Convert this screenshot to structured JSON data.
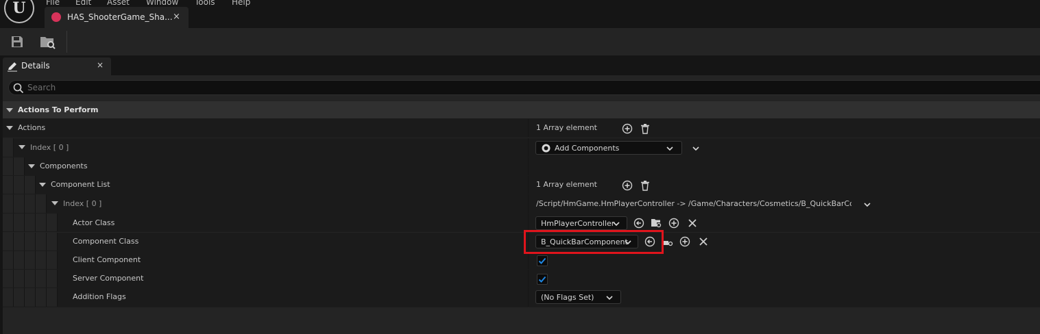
{
  "menu": [
    "File",
    "Edit",
    "Asset",
    "Window",
    "Tools",
    "Help"
  ],
  "asset_tab": {
    "label": "HAS_ShooterGame_Sha...",
    "close": "×"
  },
  "details_tab": {
    "label": "Details",
    "close": "×"
  },
  "search": {
    "placeholder": "Search",
    "value": ""
  },
  "rows": {
    "actions_to_perform": "Actions To Perform",
    "actions": {
      "label": "Actions",
      "value": "1 Array element"
    },
    "index0": {
      "label": "Index [ 0 ]",
      "value": "Add Components"
    },
    "components": "Components",
    "component_list": {
      "label": "Component List",
      "value": "1 Array element"
    },
    "index0_inner": {
      "label": "Index [ 0 ]",
      "value": "/Script/HmGame.HmPlayerController -> /Game/Characters/Cosmetics/B_QuickBarCompor"
    },
    "actor_class": {
      "label": "Actor Class",
      "value": "HmPlayerController"
    },
    "component_class": {
      "label": "Component Class",
      "value": "B_QuickBarComponent"
    },
    "client_component": {
      "label": "Client Component",
      "checked": true
    },
    "server_component": {
      "label": "Server Component",
      "checked": true
    },
    "addition_flags": {
      "label": "Addition Flags",
      "value": "(No Flags Set)"
    }
  },
  "colors": {
    "accent_highlight": "#e0141c",
    "check": "#1e88e5",
    "asset_icon": "#d7335a"
  }
}
